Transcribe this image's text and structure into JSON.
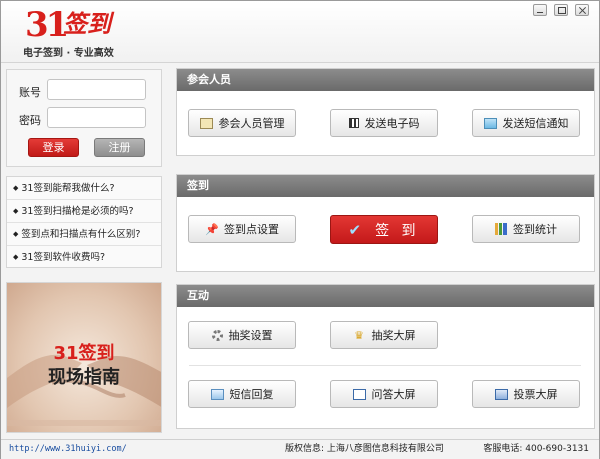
{
  "header": {
    "logo_number": "31",
    "logo_text": "签到",
    "slogan": "电子签到 · 专业高效"
  },
  "login": {
    "account_label": "账号",
    "password_label": "密码",
    "account_value": "",
    "password_value": "",
    "login_label": "登录",
    "register_label": "注册"
  },
  "faq": {
    "items": [
      {
        "label": "31签到能帮我做什么?"
      },
      {
        "label": "31签到扫描枪是必须的吗?"
      },
      {
        "label": "签到点和扫描点有什么区别?"
      },
      {
        "label": "31签到软件收费吗?"
      }
    ]
  },
  "promo": {
    "line1": "31签到",
    "line2": "现场指南"
  },
  "panels": {
    "participants": {
      "title": "参会人员",
      "manage_label": "参会人员管理",
      "send_code_label": "发送电子码",
      "sms_label": "发送短信通知"
    },
    "checkin": {
      "title": "签到",
      "point_settings_label": "签到点设置",
      "checkin_label": "签 到",
      "stats_label": "签到统计"
    },
    "interaction": {
      "title": "互动",
      "lottery_settings_label": "抽奖设置",
      "lottery_screen_label": "抽奖大屏",
      "sms_reply_label": "短信回复",
      "qa_screen_label": "问答大屏",
      "vote_screen_label": "投票大屏"
    }
  },
  "footer": {
    "url": "http://www.31huiyi.com/",
    "copyright": "版权信息: 上海八彦图信息科技有限公司",
    "phone": "客服电话: 400-690-3131"
  },
  "colors": {
    "brand_red": "#d8201c",
    "panel_header": "#7a7a7a"
  }
}
